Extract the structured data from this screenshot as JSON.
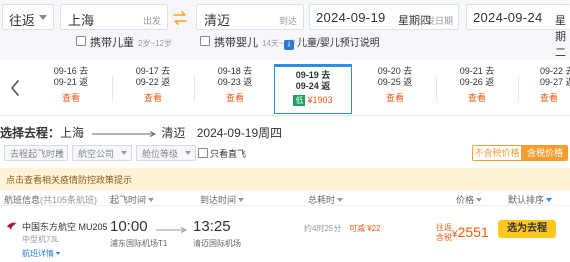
{
  "search": {
    "trip_type": "往返",
    "dep_city": "上海",
    "dep_tag": "出发",
    "arr_city": "清迈",
    "arr_tag": "到达",
    "dep_date": "2024-09-19",
    "dep_weekday": "星期四",
    "dep_date_tag": "出发日期",
    "ret_date": "2024-09-24",
    "ret_weekday": "星期二",
    "child_label": "携带儿童",
    "child_hint": "2岁~12岁",
    "infant_label": "携带婴儿",
    "infant_hint": "14天~2岁",
    "info_link": "儿童/婴儿预订说明"
  },
  "date_strip": [
    {
      "dep": "09-16 去",
      "ret": "09-21 返",
      "price": "查看"
    },
    {
      "dep": "09-17 去",
      "ret": "09-22 返",
      "price": "查看"
    },
    {
      "dep": "09-18 去",
      "ret": "09-23 返",
      "price": "查看"
    },
    {
      "dep": "09-19 去",
      "ret": "09-24 返",
      "price": "¥1903",
      "badge": "低",
      "active": true
    },
    {
      "dep": "09-20 去",
      "ret": "09-25 返",
      "price": "查看"
    },
    {
      "dep": "09-21 去",
      "ret": "09-26 返",
      "price": "查看"
    },
    {
      "dep": "09-22 去",
      "ret": "09-27 返",
      "price": "查看"
    }
  ],
  "route": {
    "label": "选择去程：",
    "from": "上海",
    "to": "清迈",
    "date": "2024-09-19周四"
  },
  "filters": {
    "time": "去程起飞时段",
    "airline": "航空公司",
    "cabin": "舱位等级",
    "direct": "只看直飞",
    "price_off": "不含税价格",
    "price_on": "含税价格"
  },
  "notice": "点击查看相关疫情防控政策提示",
  "table_header": {
    "airline": "航班信息",
    "airline_count": "(共105条航班)",
    "dep": "起飞时间",
    "arr": "到达时间",
    "duration": "总耗时",
    "price": "价格",
    "sort": "默认排序"
  },
  "flight": {
    "airline_name": "中国东方航空 MU205",
    "aircraft": "中型机73L",
    "detail": "航班详情",
    "dep_time": "10:00",
    "dep_airport": "浦东国际机场T1",
    "arr_time": "13:25",
    "arr_airport": "清迈国际机场",
    "duration": "约4时25分",
    "discount": "可减 ¥22",
    "price_label_1": "往返",
    "price_label_2": "含税",
    "price_currency": "¥",
    "price": "2551",
    "select": "选为去程"
  },
  "colors": {
    "accent_blue": "#2d8fe3",
    "price_orange": "#f05a0e",
    "button_yellow": "#ffc71f",
    "low_green": "#19a15f",
    "airline_red": "#c8102e"
  }
}
